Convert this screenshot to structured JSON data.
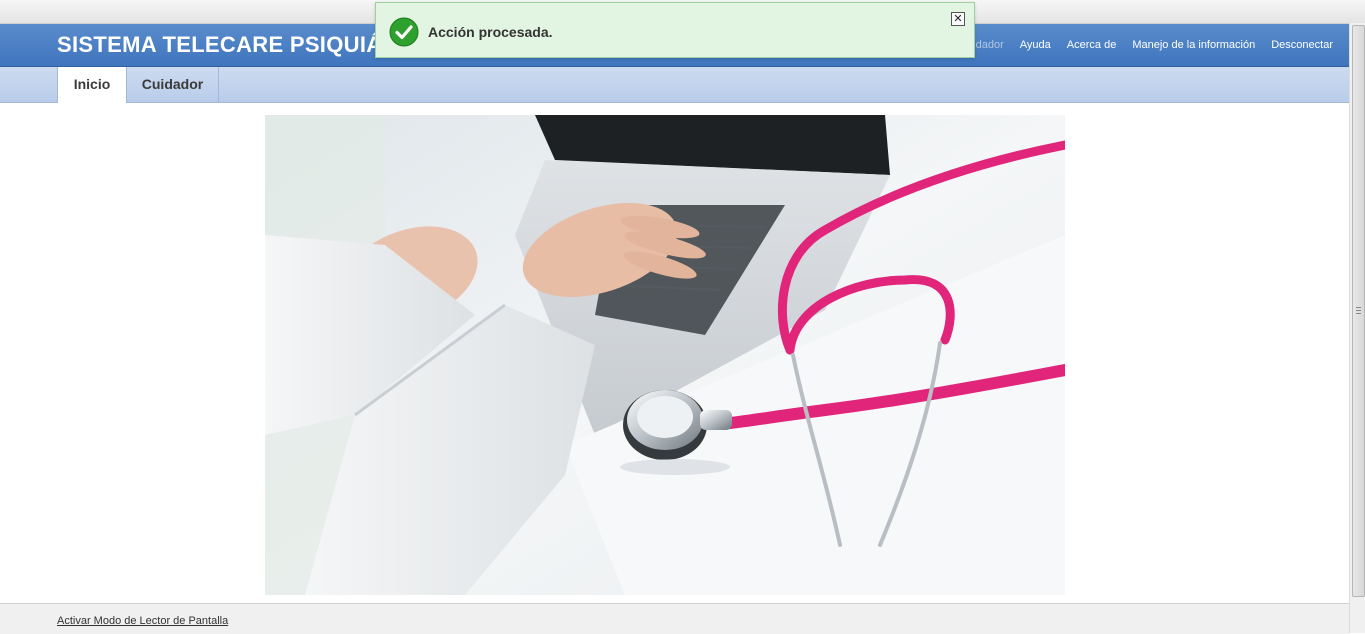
{
  "header": {
    "title": "SISTEMA TELECARE PSIQUIÁTRICO",
    "user_label": "cuidador",
    "nav": [
      "Ayuda",
      "Acerca de",
      "Manejo de la información",
      "Desconectar"
    ]
  },
  "tabs": [
    {
      "label": "Inicio",
      "active": true
    },
    {
      "label": "Cuidador",
      "active": false
    }
  ],
  "toast": {
    "message": "Acción procesada.",
    "icon": "check-circle-icon",
    "close_icon": "close-icon"
  },
  "hero": {
    "image_description_icon": "stethoscope-laptop-image"
  },
  "footer": {
    "screen_reader_link": "Activar Modo de Lector de Pantalla"
  },
  "colors": {
    "header": "#4a80c4",
    "tabs_bar": "#c2d3ed",
    "toast_bg": "#e2f4e2",
    "stethoscope": "#e0257a"
  }
}
